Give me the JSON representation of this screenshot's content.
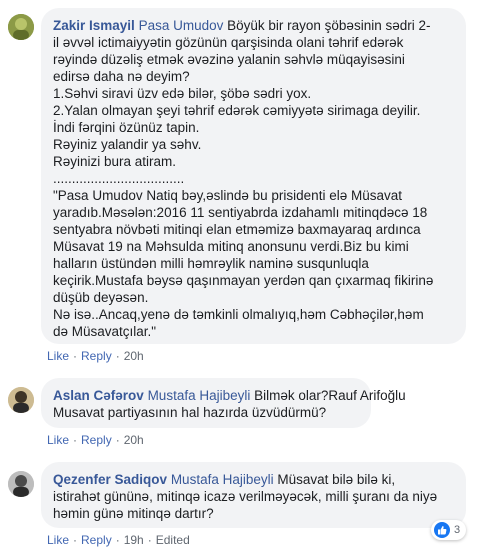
{
  "colors": {
    "name_link": "#385898",
    "action_link": "#4267b2",
    "bubble_bg": "#f2f3f5",
    "meta_gray": "#606770",
    "like_blue": "#1877f2"
  },
  "comments": [
    {
      "author": "Zakir Ismayil",
      "mention": "Pasa Umudov",
      "first_line": " Böyük bir rayon şöbəsinin sədri 2-",
      "lines": [
        "il əvvəl ictimaiyyətin gözünün qarşisinda olani təhrif edərək",
        "rəyində düzəliş etmək əvəzinə yalanin səhvlə müqayisəsini",
        "edirsə daha nə deyim?",
        "1.Səhvi siravi üzv edə bilər, şöbə sədri yox.",
        "2.Yalan olmayan şeyi təhrif edərək cəmiyyətə sirimaga deyilir.",
        "İndi fərqini özünüz tapin.",
        "Rəyiniz yalandir ya səhv.",
        "Rəyinizi bura atiram.",
        "...................................",
        "\"Pasa Umudov Natiq bəy,əslində bu prisidenti elə Müsavat",
        "yaradıb.Məsələn:2016 11 sentiyabrda izdahamlı mitinqdəcə 18",
        "sentyabra növbəti mitinqi elan etməmizə baxmayaraq ardınca",
        "Müsavat 19 na Məhsulda mitinq anonsunu verdi.Biz bu kimi",
        "halların üstündən milli həmrəylik naminə susqunluqla",
        "keçirik.Mustafa bəysə qaşınmayan yerdən qan çıxarmaq fikirinə",
        "düşüb deyəsən.",
        "Nə isə..Ancaq,yenə də təmkinli olmalıyıq,həm Cəbhəçilər,həm",
        "də Müsavatçılar.\""
      ],
      "actions": {
        "like": "Like",
        "reply": "Reply",
        "time": "20h"
      }
    },
    {
      "author": "Aslan Cəfərov",
      "mention": "Mustafa Hajibeyli",
      "first_line": " Bilmək olar?Rauf Arifoğlu",
      "lines": [
        "Musavat partiyasının hal hazırda üzvüdürmü?"
      ],
      "actions": {
        "like": "Like",
        "reply": "Reply",
        "time": "20h"
      }
    },
    {
      "author": "Qezenfer Sadiqov",
      "mention": "Mustafa Hajibeyli",
      "first_line": " Müsavat bilə bilə ki,",
      "lines": [
        "istirahət gününə, mitinqə icazə verilməyəcək, milli şuranı da niyə",
        "həmin günə mitinqə dartır?"
      ],
      "actions": {
        "like": "Like",
        "reply": "Reply",
        "time": "19h",
        "edited": "Edited"
      },
      "reaction_count": "3"
    }
  ]
}
